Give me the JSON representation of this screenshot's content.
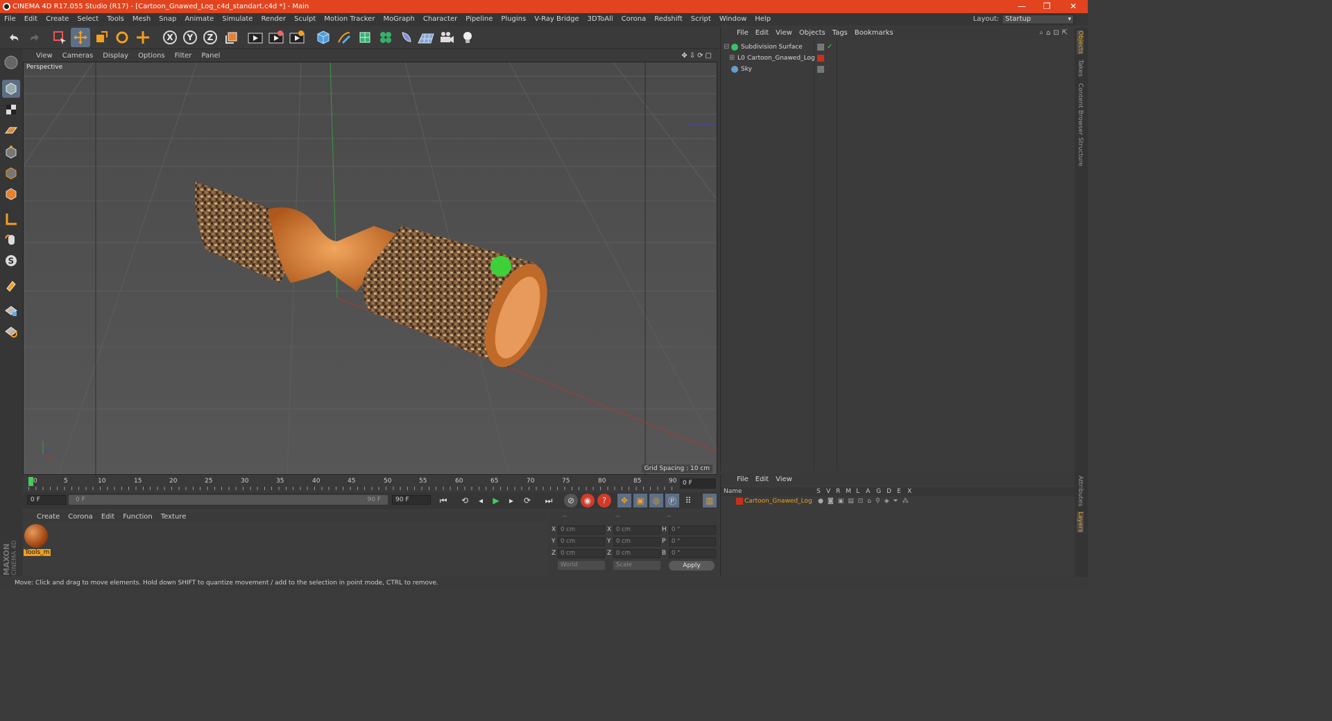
{
  "window": {
    "title": "CINEMA 4D R17.055 Studio (R17) - [Cartoon_Gnawed_Log_c4d_standart.c4d *] - Main",
    "controls": [
      "—",
      "❐",
      "✕"
    ],
    "accent": "#e1441f"
  },
  "menubar": {
    "items": [
      "File",
      "Edit",
      "Create",
      "Select",
      "Tools",
      "Mesh",
      "Snap",
      "Animate",
      "Simulate",
      "Render",
      "Sculpt",
      "Motion Tracker",
      "MoGraph",
      "Character",
      "Pipeline",
      "Plugins",
      "V-Ray Bridge",
      "3DToAll",
      "Corona",
      "Redshift",
      "Script",
      "Window",
      "Help"
    ],
    "layout_label": "Layout:",
    "layout_value": "Startup"
  },
  "toolbar": {
    "icons": [
      "undo-icon",
      "redo-icon",
      "select-icon",
      "move-icon",
      "scale-icon",
      "rotate-icon",
      "last-tool-icon",
      "x-axis-icon",
      "y-axis-icon",
      "z-axis-icon",
      "coordinate-system-icon",
      "render-view-icon",
      "render-picture-viewer-icon",
      "render-settings-icon",
      "cube-icon",
      "pen-icon",
      "subdivision-icon",
      "cloner-icon",
      "deformer-icon",
      "floor-icon",
      "camera-icon",
      "light-icon"
    ],
    "axis_labels": [
      "X",
      "Y",
      "Z"
    ]
  },
  "viewport": {
    "menu": [
      "View",
      "Cameras",
      "Display",
      "Options",
      "Filter",
      "Panel"
    ],
    "label": "Perspective",
    "grid_spacing": "Grid Spacing : 10 cm"
  },
  "timeline": {
    "ticks": [
      "0",
      "5",
      "10",
      "15",
      "20",
      "25",
      "30",
      "35",
      "40",
      "45",
      "50",
      "55",
      "60",
      "65",
      "70",
      "75",
      "80",
      "85",
      "90"
    ],
    "current_frame": "0 F",
    "start_field": "0 F",
    "range_start": "0 F",
    "range_end": "90 F",
    "end_field": "90 F"
  },
  "material_manager": {
    "menu": [
      "Create",
      "Corona",
      "Edit",
      "Function",
      "Texture"
    ],
    "material_name": "Tools_m"
  },
  "branding": {
    "line1": "MAXON",
    "line2": "CINEMA 4D"
  },
  "coordinates": {
    "headers": [
      "--",
      "--",
      "--"
    ],
    "rows": [
      {
        "a": "X",
        "av": "0 cm",
        "b": "X",
        "bv": "0 cm",
        "c": "H",
        "cv": "0 °"
      },
      {
        "a": "Y",
        "av": "0 cm",
        "b": "Y",
        "bv": "0 cm",
        "c": "P",
        "cv": "0 °"
      },
      {
        "a": "Z",
        "av": "0 cm",
        "b": "Z",
        "bv": "0 cm",
        "c": "B",
        "cv": "0 °"
      }
    ],
    "mode_world": "World",
    "mode_scale": "Scale",
    "apply": "Apply"
  },
  "status": "Move: Click and drag to move elements. Hold down SHIFT to quantize movement / add to the selection in point mode, CTRL to remove.",
  "object_manager": {
    "menu": [
      "File",
      "Edit",
      "View",
      "Objects",
      "Tags",
      "Bookmarks"
    ],
    "objects": [
      {
        "name": "Subdivision Surface",
        "icon_color": "#35c46a"
      },
      {
        "name": "Cartoon_Gnawed_Log",
        "icon_color": "#e0e0e0"
      },
      {
        "name": "Sky",
        "icon_color": "#6b9bd1"
      }
    ]
  },
  "layer_manager": {
    "menu": [
      "File",
      "Edit",
      "View"
    ],
    "columns": [
      "Name",
      "S",
      "V",
      "R",
      "M",
      "L",
      "A",
      "G",
      "D",
      "E",
      "X"
    ],
    "layer_name": "Cartoon_Gnawed_Log",
    "layer_color": "#c8301c"
  },
  "right_tabs": [
    "Objects",
    "Takes",
    "Content Browser",
    "Structure",
    "Attributes",
    "Layers"
  ]
}
